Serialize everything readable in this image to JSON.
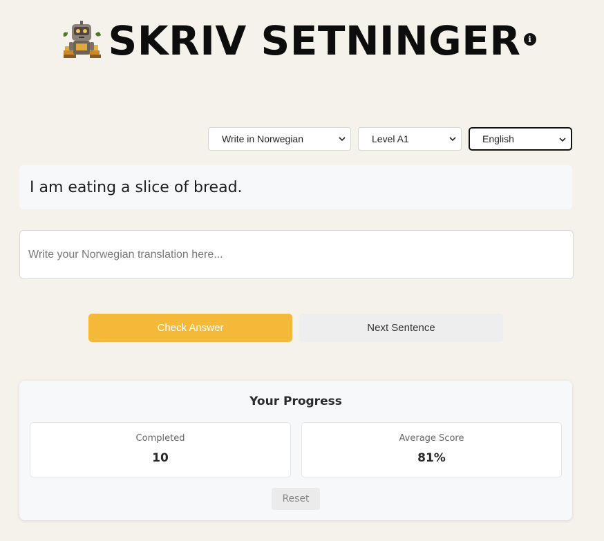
{
  "header": {
    "title": "SKRIV SETNINGER",
    "info_icon": "info-icon",
    "logo_icon": "robot-mascot-icon"
  },
  "controls": {
    "mode_select": {
      "selected": "Write in Norwegian"
    },
    "level_select": {
      "selected": "Level A1"
    },
    "language_select": {
      "selected": "English"
    }
  },
  "exercise": {
    "prompt_sentence": "I am eating a slice of bread.",
    "answer_value": "",
    "answer_placeholder": "Write your Norwegian translation here..."
  },
  "actions": {
    "check_label": "Check Answer",
    "next_label": "Next Sentence"
  },
  "progress": {
    "title": "Your Progress",
    "completed_label": "Completed",
    "completed_value": "10",
    "score_label": "Average Score",
    "score_value": "81%",
    "reset_label": "Reset"
  },
  "colors": {
    "background": "#f5f2ec",
    "accent": "#f4b938",
    "secondary_button": "#eeeeee",
    "card": "#f7f8fa"
  }
}
